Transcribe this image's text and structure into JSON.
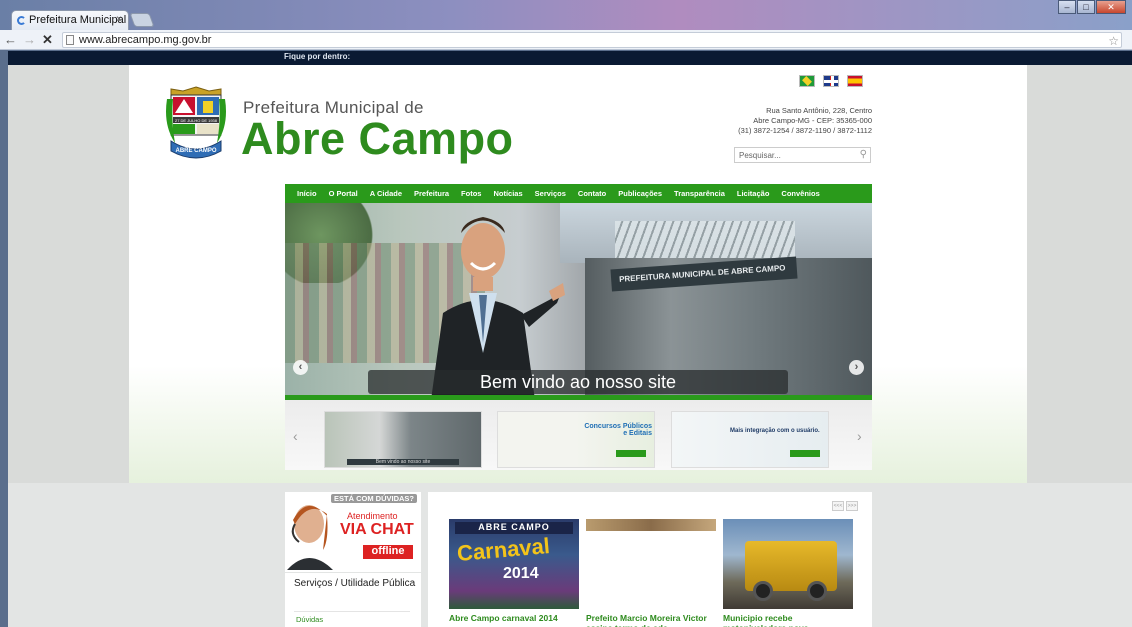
{
  "browser": {
    "tab_title": "Prefeitura Municipal",
    "tab_close": "×",
    "url": "www.abrecampo.mg.gov.br",
    "nav": {
      "back": "←",
      "forward": "→",
      "stop": "✕"
    }
  },
  "site": {
    "topbar_text": "Fique por dentro:",
    "header": {
      "small_title": "Prefeitura Municipal de",
      "big_title": "Abre Campo",
      "address_line1": "Rua Santo Antônio, 228, Centro",
      "address_line2": "Abre Campo-MG - CEP: 35365-000",
      "phones": "(31) 3872-1254 / 3872-1190 / 3872-1112",
      "search_placeholder": "Pesquisar...",
      "languages": [
        "portugues",
        "english",
        "español"
      ]
    },
    "menu": [
      "Início",
      "O Portal",
      "A Cidade",
      "Prefeitura",
      "Fotos",
      "Notícias",
      "Serviços",
      "Contato",
      "Publicações",
      "Transparência",
      "Licitação",
      "Convênios"
    ],
    "slider": {
      "building_sign": "PREFEITURA MUNICIPAL DE ABRE CAMPO",
      "caption": "Bem vindo ao nosso site",
      "prev": "‹",
      "next": "›"
    },
    "thumbnails": [
      {
        "label": "Bem vindo ao nosso site"
      },
      {
        "title_line1": "Concursos Públicos",
        "title_line2": "e Editais"
      },
      {
        "title": "Mais integração com o usuário."
      }
    ],
    "chat": {
      "question": "ESTÁ COM DÚVIDAS?",
      "atendimento": "Atendimento",
      "via_chat": "VIA CHAT",
      "status": "offline"
    },
    "services": {
      "title": "Serviços / Utilidade Pública",
      "first_item": "Dúvidas"
    },
    "news": {
      "pager": [
        "<<<",
        ">>>"
      ],
      "poster_header": "ABRE CAMPO",
      "poster_title": "Carnaval",
      "poster_year": "2014",
      "items": [
        {
          "caption": "Abre Campo carnaval 2014"
        },
        {
          "caption": "Prefeito Marcio Moreira Victor assina termo de ade..."
        },
        {
          "caption": "Municipio recebe motoniveladora nova"
        }
      ]
    }
  }
}
